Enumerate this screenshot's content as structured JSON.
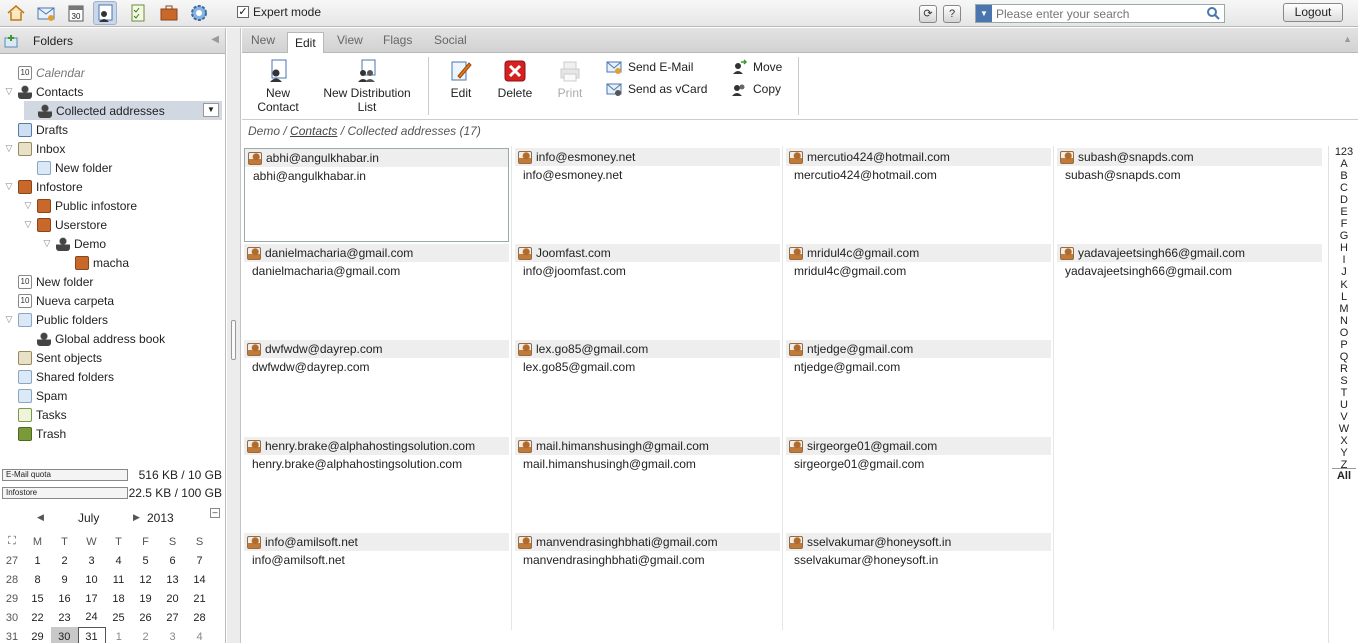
{
  "topbar": {
    "apps": [
      {
        "icon": "home-icon"
      },
      {
        "icon": "mail-icon"
      },
      {
        "icon": "calendar-icon",
        "text": "30"
      },
      {
        "icon": "contacts-icon",
        "active": true
      },
      {
        "icon": "tasks-icon"
      },
      {
        "icon": "infostore-icon"
      },
      {
        "icon": "settings-icon"
      }
    ],
    "expert_mode_label": "Expert mode",
    "expert_mode_checked": true,
    "search_placeholder": "Please enter your search",
    "logout_label": "Logout"
  },
  "sidebar": {
    "header": "Folders",
    "tree": [
      {
        "label": "Calendar",
        "icon": "calendar-icon",
        "indent": 1,
        "italic": true
      },
      {
        "label": "Contacts",
        "icon": "contacts-icon",
        "indent": 1,
        "expanded": true
      },
      {
        "label": "Collected addresses",
        "icon": "contacts-icon",
        "indent": 2,
        "selected": true
      },
      {
        "label": "Drafts",
        "icon": "drafts-icon",
        "indent": 1
      },
      {
        "label": "Inbox",
        "icon": "inbox-icon",
        "indent": 1,
        "expanded": true
      },
      {
        "label": "New folder",
        "icon": "folder-icon",
        "indent": 2
      },
      {
        "label": "Infostore",
        "icon": "infostore-icon",
        "indent": 1,
        "expanded": true
      },
      {
        "label": "Public infostore",
        "icon": "infostore-icon",
        "indent": 2,
        "expanded": true
      },
      {
        "label": "Userstore",
        "icon": "infostore-icon",
        "indent": 2,
        "expanded": true
      },
      {
        "label": "Demo",
        "icon": "user-icon",
        "indent": 3,
        "expanded": true
      },
      {
        "label": "macha",
        "icon": "infostore-icon",
        "indent": 4
      },
      {
        "label": "New folder",
        "icon": "calendar-icon",
        "indent": 1
      },
      {
        "label": "Nueva carpeta",
        "icon": "calendar-icon",
        "indent": 1
      },
      {
        "label": "Public folders",
        "icon": "folder-icon",
        "indent": 1,
        "expanded": true
      },
      {
        "label": "Global address book",
        "icon": "contacts-icon",
        "indent": 2
      },
      {
        "label": "Sent objects",
        "icon": "sent-icon",
        "indent": 1
      },
      {
        "label": "Shared folders",
        "icon": "folder-icon",
        "indent": 1
      },
      {
        "label": "Spam",
        "icon": "spam-icon",
        "indent": 1
      },
      {
        "label": "Tasks",
        "icon": "tasks-icon",
        "indent": 1
      },
      {
        "label": "Trash",
        "icon": "trash-icon",
        "indent": 1
      }
    ],
    "quota": [
      {
        "label": "E-Mail quota",
        "value": "516 KB / 10 GB"
      },
      {
        "label": "Infostore",
        "value": "22.5 KB / 100 GB"
      }
    ],
    "minical": {
      "month": "July",
      "year": "2013",
      "weekdays": [
        "M",
        "T",
        "W",
        "T",
        "F",
        "S",
        "S"
      ],
      "weeks": [
        {
          "wk": "27",
          "days": [
            "1",
            "2",
            "3",
            "4",
            "5",
            "6",
            "7"
          ]
        },
        {
          "wk": "28",
          "days": [
            "8",
            "9",
            "10",
            "11",
            "12",
            "13",
            "14"
          ]
        },
        {
          "wk": "29",
          "days": [
            "15",
            "16",
            "17",
            "18",
            "19",
            "20",
            "21"
          ]
        },
        {
          "wk": "30",
          "days": [
            "22",
            "23",
            "24",
            "25",
            "26",
            "27",
            "28"
          ]
        },
        {
          "wk": "31",
          "days": [
            "29",
            "30",
            "31",
            "1",
            "2",
            "3",
            "4"
          ]
        }
      ]
    }
  },
  "tabs": [
    "New",
    "Edit",
    "View",
    "Flags",
    "Social"
  ],
  "active_tab": "Edit",
  "ribbon": {
    "new_contact": "New Contact",
    "new_contact_l1": "New",
    "new_contact_l2": "Contact",
    "new_list_l1": "New Distribution",
    "new_list_l2": "List",
    "edit": "Edit",
    "delete": "Delete",
    "print": "Print",
    "send_email": "Send E-Mail",
    "send_vcard": "Send as vCard",
    "move": "Move",
    "copy": "Copy"
  },
  "breadcrumb": {
    "root": "Demo",
    "sep": "/",
    "contacts": "Contacts",
    "current": "Collected addresses (17)"
  },
  "contacts": [
    {
      "name": "abhi@angulkhabar.in",
      "email": "abhi@angulkhabar.in",
      "selected": true
    },
    {
      "name": "info@esmoney.net",
      "email": "info@esmoney.net"
    },
    {
      "name": "mercutio424@hotmail.com",
      "email": "mercutio424@hotmail.com"
    },
    {
      "name": "subash@snapds.com",
      "email": "subash@snapds.com"
    },
    {
      "name": "danielmacharia@gmail.com",
      "email": "danielmacharia@gmail.com"
    },
    {
      "name": "Joomfast.com",
      "email": "info@joomfast.com"
    },
    {
      "name": "mridul4c@gmail.com",
      "email": "mridul4c@gmail.com"
    },
    {
      "name": "yadavajeetsingh66@gmail.com",
      "email": "yadavajeetsingh66@gmail.com"
    },
    {
      "name": "dwfwdw@dayrep.com",
      "email": "dwfwdw@dayrep.com"
    },
    {
      "name": "lex.go85@gmail.com",
      "email": "lex.go85@gmail.com"
    },
    {
      "name": "ntjedge@gmail.com",
      "email": "ntjedge@gmail.com"
    },
    null,
    {
      "name": "henry.brake@alphahostingsolution.com",
      "email": "henry.brake@alphahostingsolution.com"
    },
    {
      "name": "mail.himanshusingh@gmail.com",
      "email": "mail.himanshusingh@gmail.com"
    },
    {
      "name": "sirgeorge01@gmail.com",
      "email": "sirgeorge01@gmail.com"
    },
    null,
    {
      "name": "info@amilsoft.net",
      "email": "info@amilsoft.net"
    },
    {
      "name": "manvendrasinghbhati@gmail.com",
      "email": "manvendrasinghbhati@gmail.com"
    },
    {
      "name": "sselvakumar@honeysoft.in",
      "email": "sselvakumar@honeysoft.in"
    }
  ],
  "alphabet": [
    "123",
    "A",
    "B",
    "C",
    "D",
    "E",
    "F",
    "G",
    "H",
    "I",
    "J",
    "K",
    "L",
    "M",
    "N",
    "O",
    "P",
    "Q",
    "R",
    "S",
    "T",
    "U",
    "V",
    "W",
    "X",
    "Y",
    "Z",
    "All"
  ],
  "colors": {
    "accent": "#4a76b0",
    "selection": "#d1d8e2",
    "card_header": "#eeeeee",
    "delete_red": "#d42020"
  }
}
